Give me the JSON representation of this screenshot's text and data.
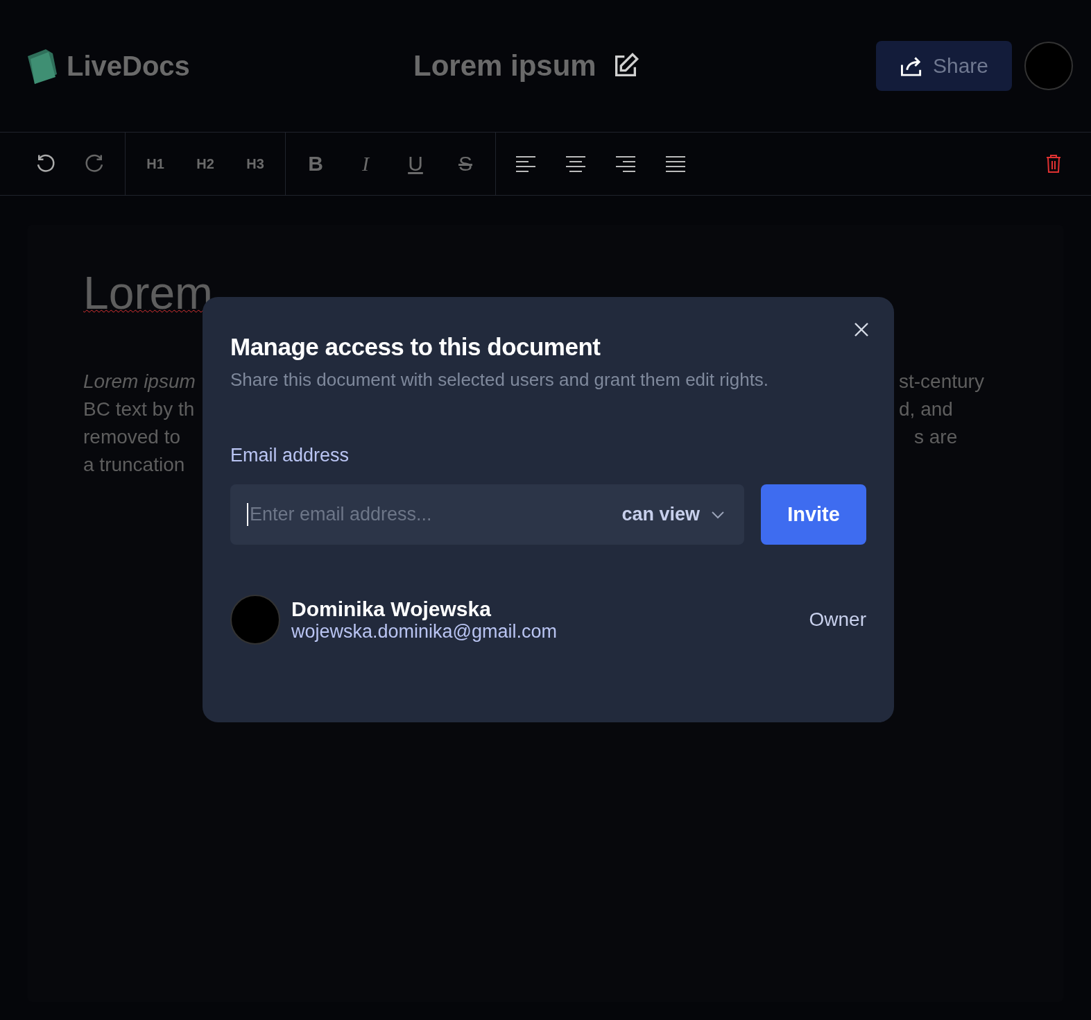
{
  "header": {
    "app_name": "LiveDocs",
    "document_title": "Lorem ipsum",
    "share_button": "Share"
  },
  "toolbar": {
    "headings": [
      "H1",
      "H2",
      "H3"
    ],
    "formats": [
      {
        "label": "B",
        "kind": "bold"
      },
      {
        "label": "I",
        "kind": "italic"
      },
      {
        "label": "U",
        "kind": "underline"
      },
      {
        "label": "S",
        "kind": "strike"
      }
    ]
  },
  "document": {
    "heading": "Lorem",
    "paragraph_left": [
      {
        "text": "Lorem ipsum",
        "kind": "italic"
      },
      {
        "text": "BC text by th",
        "kind": "plain"
      },
      {
        "text": "removed to",
        "kind": "plain"
      },
      {
        "text": "a truncation",
        "kind": "plain"
      }
    ],
    "paragraph_right": [
      "st-century",
      "d, and",
      "s are"
    ]
  },
  "dialog": {
    "title": "Manage access to this document",
    "subtitle": "Share this document with selected users and grant them edit rights.",
    "email_label": "Email address",
    "email_placeholder": "Enter email address...",
    "permission": "can view",
    "invite_button": "Invite",
    "users": [
      {
        "name": "Dominika Wojewska",
        "email": "wojewska.dominika@gmail.com",
        "role": "Owner"
      }
    ]
  }
}
